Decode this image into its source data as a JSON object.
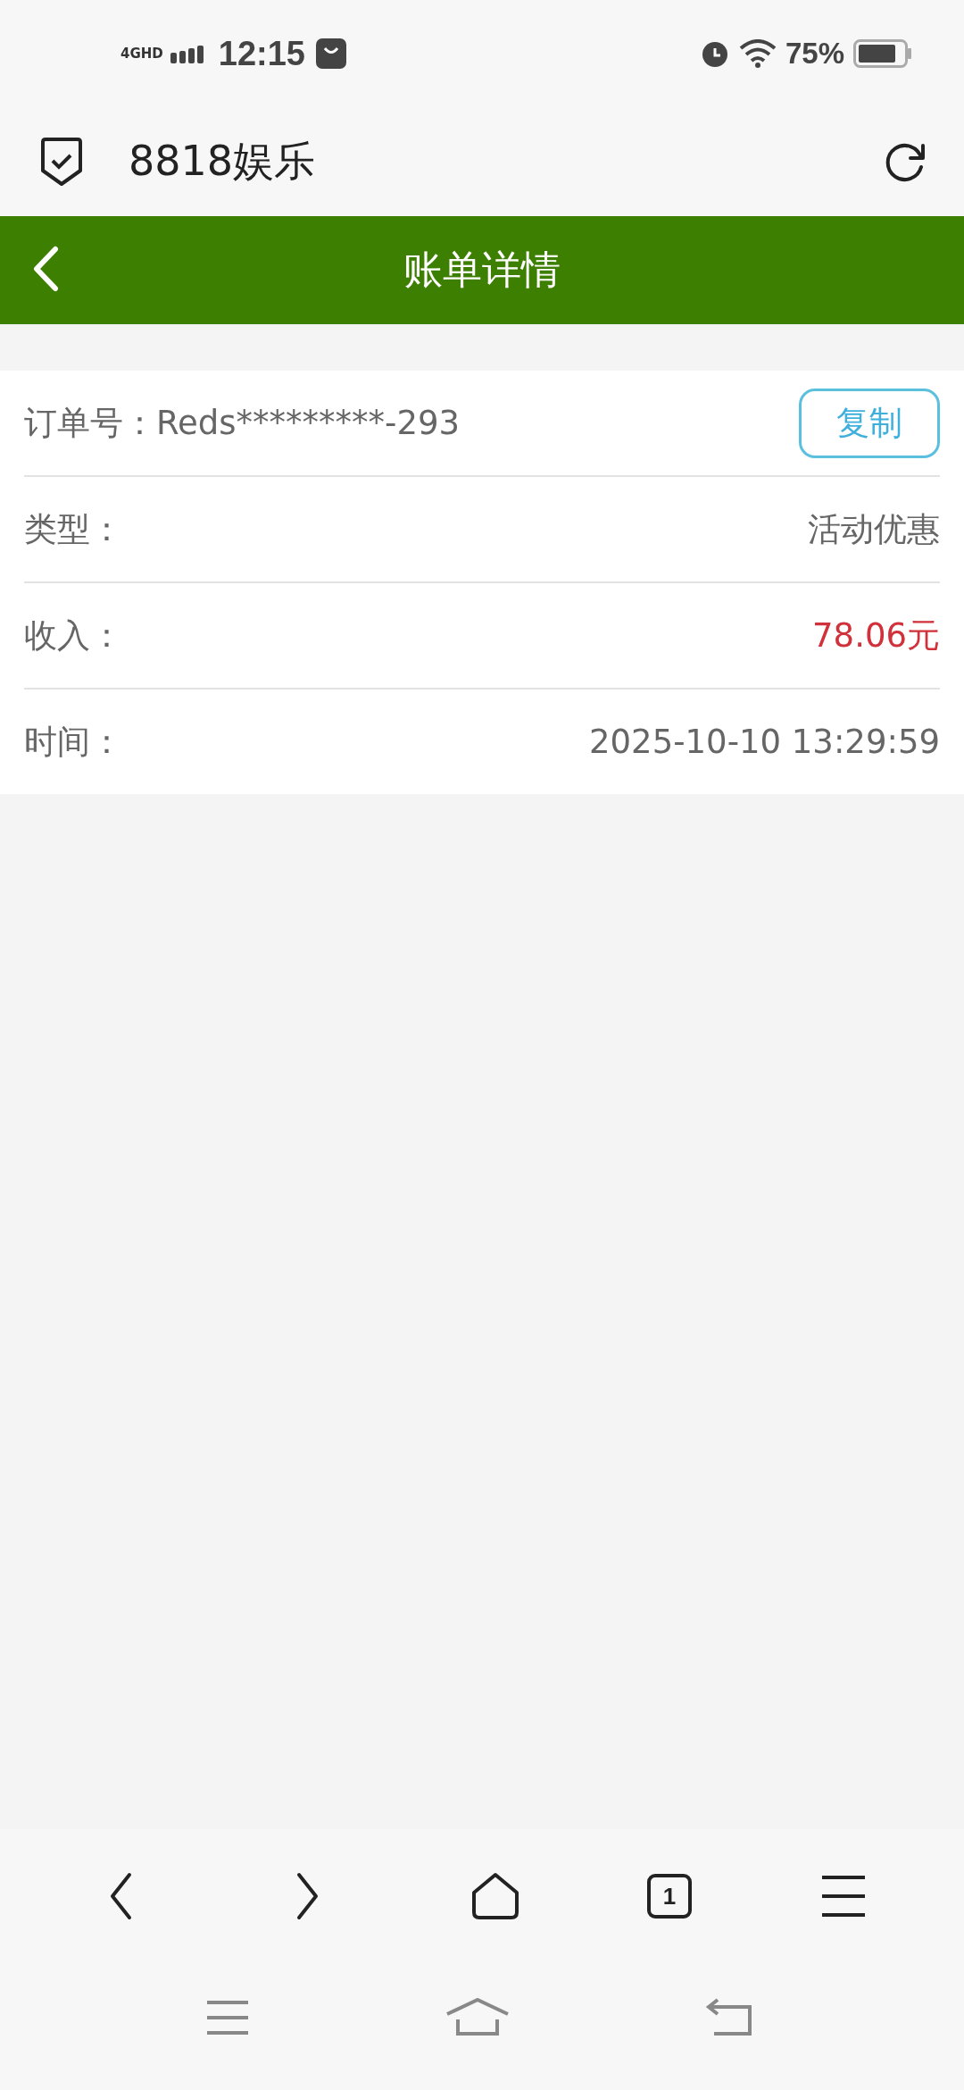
{
  "status_bar": {
    "network": "4GHD",
    "time": "12:15",
    "battery": "75%"
  },
  "browser": {
    "title": "8818娱乐"
  },
  "header": {
    "title": "账单详情"
  },
  "details": [
    {
      "kind": "copyable",
      "label": "订单号：",
      "value": "Reds*********-293",
      "button": "复制"
    },
    {
      "kind": "plain",
      "label": "类型：",
      "value": "活动优惠"
    },
    {
      "kind": "amount",
      "label": "收入：",
      "value": "78.06元"
    },
    {
      "kind": "plain",
      "label": "时间：",
      "value": "2025-10-10 13:29:59"
    }
  ],
  "toolbar": {
    "tab_count": "1"
  }
}
